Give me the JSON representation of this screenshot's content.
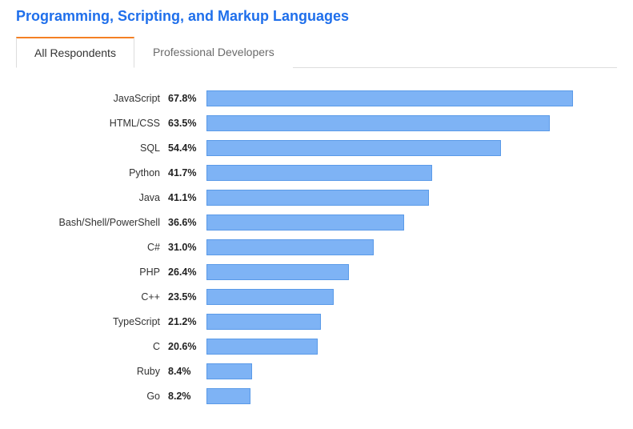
{
  "title": "Programming, Scripting, and Markup Languages",
  "tabs": [
    {
      "label": "All Respondents",
      "active": true
    },
    {
      "label": "Professional Developers",
      "active": false
    }
  ],
  "chart_data": {
    "type": "bar",
    "orientation": "horizontal",
    "title": "Programming, Scripting, and Markup Languages",
    "xlabel": "",
    "ylabel": "",
    "xlim": [
      0,
      70
    ],
    "categories": [
      "JavaScript",
      "HTML/CSS",
      "SQL",
      "Python",
      "Java",
      "Bash/Shell/PowerShell",
      "C#",
      "PHP",
      "C++",
      "TypeScript",
      "C",
      "Ruby",
      "Go"
    ],
    "values": [
      67.8,
      63.5,
      54.4,
      41.7,
      41.1,
      36.6,
      31.0,
      26.4,
      23.5,
      21.2,
      20.6,
      8.4,
      8.2
    ],
    "value_suffix": "%",
    "colors": {
      "bar_fill": "#7eb3f5",
      "bar_border": "#5a9ae8",
      "accent": "#f48024",
      "title": "#1f6feb"
    }
  }
}
